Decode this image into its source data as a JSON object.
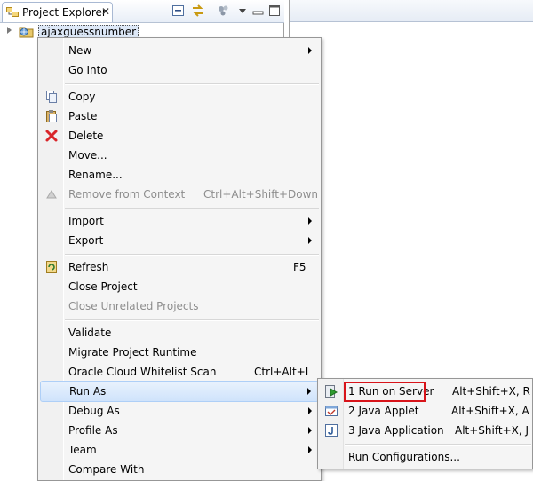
{
  "explorer": {
    "tab_title": "Project Explorer",
    "tab_icon": "project-explorer-icon",
    "close_glyph": "✕",
    "project_name": "ajaxguessnumber"
  },
  "context_menu": {
    "items": [
      {
        "label": "New"
      },
      {
        "label": "Go Into"
      },
      {
        "label": "Copy"
      },
      {
        "label": "Paste"
      },
      {
        "label": "Delete"
      },
      {
        "label": "Move..."
      },
      {
        "label": "Rename..."
      },
      {
        "label": "Remove from Context",
        "shortcut": "Ctrl+Alt+Shift+Down"
      },
      {
        "label": "Import"
      },
      {
        "label": "Export"
      },
      {
        "label": "Refresh",
        "shortcut": "F5"
      },
      {
        "label": "Close Project"
      },
      {
        "label": "Close Unrelated Projects"
      },
      {
        "label": "Validate"
      },
      {
        "label": "Migrate Project Runtime"
      },
      {
        "label": "Oracle Cloud Whitelist Scan",
        "shortcut": "Ctrl+Alt+L"
      },
      {
        "label": "Run As"
      },
      {
        "label": "Debug As"
      },
      {
        "label": "Profile As"
      },
      {
        "label": "Team"
      },
      {
        "label": "Compare With"
      }
    ]
  },
  "run_as_submenu": {
    "items": [
      {
        "label": "1 Run on Server",
        "shortcut": "Alt+Shift+X, R"
      },
      {
        "label": "2 Java Applet",
        "shortcut": "Alt+Shift+X, A"
      },
      {
        "label": "3 Java Application",
        "shortcut": "Alt+Shift+X, J"
      },
      {
        "label": "Run Configurations..."
      }
    ]
  },
  "colors": {
    "highlight_box": "#d8141a",
    "hover_fill": "#cfe3fb"
  }
}
